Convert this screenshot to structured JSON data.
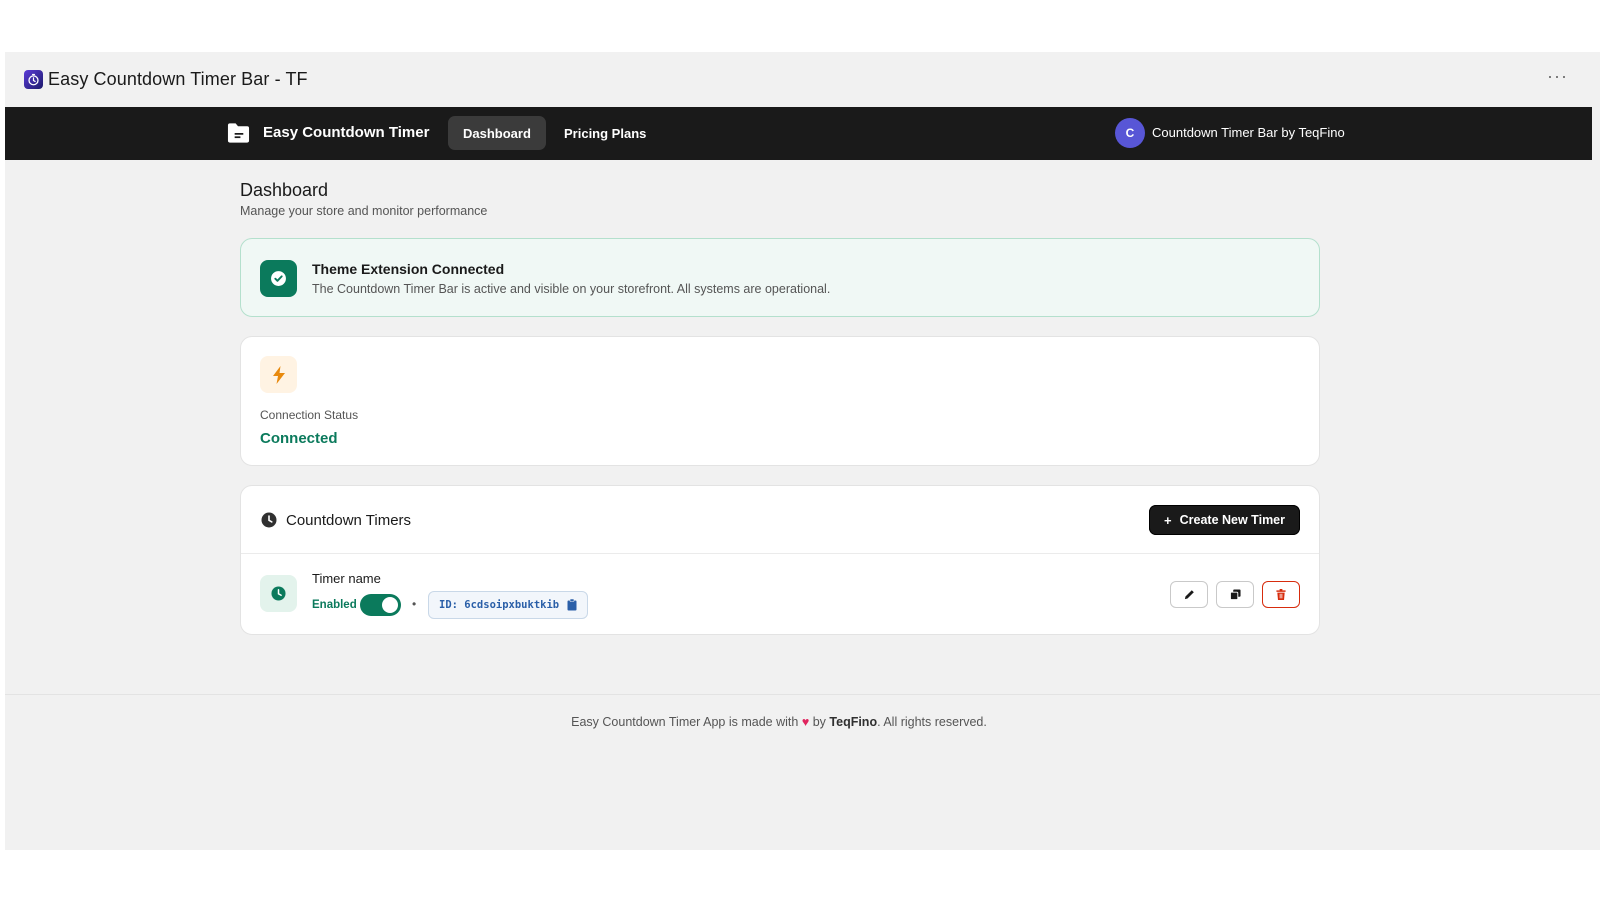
{
  "window": {
    "title": "Easy Countdown Timer Bar - TF",
    "more_label": "···"
  },
  "nav": {
    "brand": "Easy Countdown Timer",
    "tabs": [
      {
        "label": "Dashboard",
        "active": true
      },
      {
        "label": "Pricing Plans",
        "active": false
      }
    ],
    "avatar_letter": "C",
    "shop_name": "Countdown Timer Bar by TeqFino"
  },
  "page": {
    "title": "Dashboard",
    "subtitle": "Manage your store and monitor performance"
  },
  "banner": {
    "title": "Theme Extension Connected",
    "text": "The Countdown Timer Bar is active and visible on your storefront. All systems are operational.",
    "icon": "check-circle-icon"
  },
  "status": {
    "icon": "bolt-icon",
    "label": "Connection Status",
    "value": "Connected"
  },
  "timers": {
    "title": "Countdown Timers",
    "create_label": "Create New Timer",
    "items": [
      {
        "name": "Timer name",
        "enabled_label": "Enabled",
        "enabled": true,
        "id_text": "ID: 6cdsoipxbuktkib"
      }
    ]
  },
  "footer": {
    "prefix": "Easy Countdown Timer App is made with",
    "by": "by",
    "company": "TeqFino",
    "suffix": ". All rights reserved."
  },
  "colors": {
    "accent_green": "#0b7a5c",
    "nav_bg": "#1a1a1a",
    "avatar": "#5856d6",
    "danger": "#d72c0d"
  }
}
